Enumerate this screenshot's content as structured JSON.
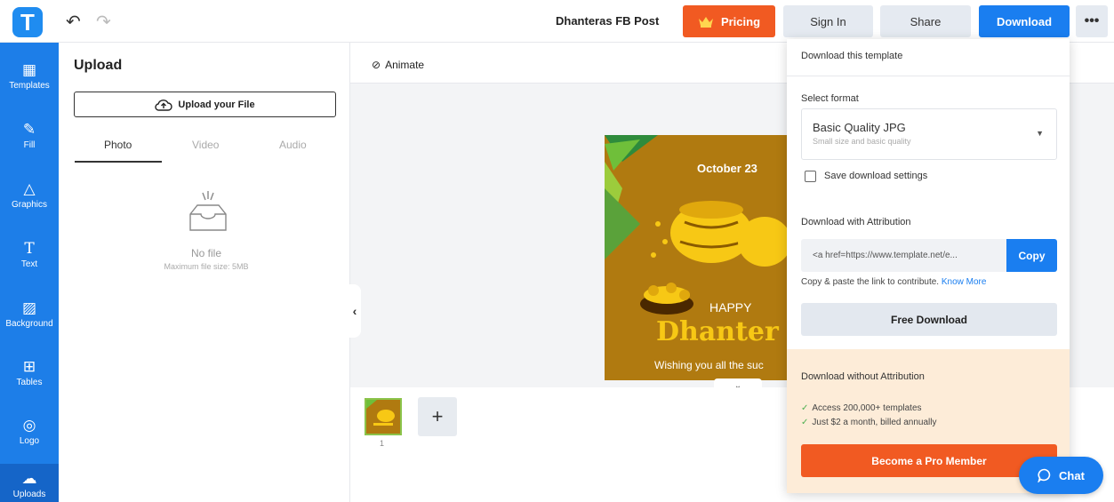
{
  "header": {
    "logo": "T",
    "doc_title": "Dhanteras FB Post",
    "pricing": "Pricing",
    "sign_in": "Sign In",
    "share": "Share",
    "download": "Download",
    "more": "•••"
  },
  "sidebar": {
    "items": [
      {
        "label": "Templates",
        "icon": "templates-icon"
      },
      {
        "label": "Fill",
        "icon": "fill-icon"
      },
      {
        "label": "Graphics",
        "icon": "graphics-icon"
      },
      {
        "label": "Text",
        "icon": "text-icon"
      },
      {
        "label": "Background",
        "icon": "background-icon"
      },
      {
        "label": "Tables",
        "icon": "tables-icon"
      },
      {
        "label": "Logo",
        "icon": "logo-icon"
      },
      {
        "label": "Uploads",
        "icon": "uploads-icon"
      }
    ]
  },
  "panel": {
    "title": "Upload",
    "upload_button": "Upload your File",
    "tabs": [
      "Photo",
      "Video",
      "Audio"
    ],
    "empty_text": "No file",
    "max_size": "Maximum file size: 5MB"
  },
  "canvas": {
    "animate": "Animate",
    "design": {
      "date": "October 23",
      "happy": "HAPPY",
      "title": "Dhanter",
      "wish": "Wishing you all the suc"
    },
    "page_number": "1",
    "add_page": "+"
  },
  "download_menu": {
    "heading": "Download this template",
    "select_format_label": "Select format",
    "format_name": "Basic Quality JPG",
    "format_sub": "Small size and basic quality",
    "save_settings": "Save download settings",
    "attribution_label": "Download with Attribution",
    "attribution_link": "<a href=https://www.template.net/e...",
    "copy": "Copy",
    "copy_hint": "Copy & paste the link to contribute.",
    "know_more": "Know More",
    "free_download": "Free Download",
    "no_attr_label": "Download without Attribution",
    "bullets": [
      "Access 200,000+ templates",
      "Just $2 a month, billed annually"
    ],
    "pro_button": "Become a Pro Member"
  },
  "chat": "Chat",
  "colors": {
    "brand_blue": "#1a7ef0",
    "accent_orange": "#f15a22",
    "design_bg": "#b07a10"
  }
}
